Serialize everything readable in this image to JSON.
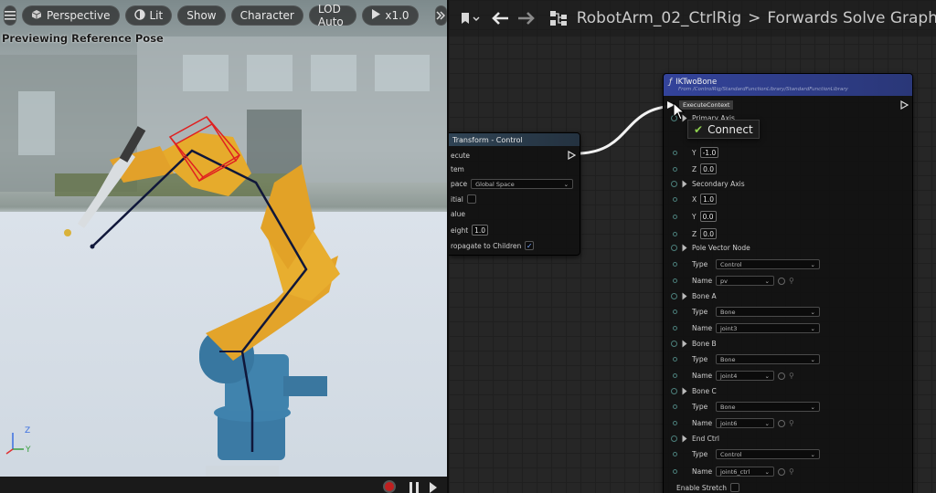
{
  "viewport": {
    "toolbar": {
      "menu_icon": "hamburger-menu-icon",
      "perspective_label": "Perspective",
      "lit_label": "Lit",
      "show_label": "Show",
      "character_label": "Character",
      "lod_label": "LOD Auto",
      "speed_label": "x1.0",
      "more_icon": "double-chevron-right-icon"
    },
    "status": "Previewing Reference Pose",
    "axis_labels": {
      "z": "Z",
      "y": "Y"
    }
  },
  "graph": {
    "breadcrumb": {
      "asset": "RobotArm_02_CtrlRig",
      "separator": ">",
      "graph_name": "Forwards Solve Graph"
    },
    "node_transform": {
      "title": "Transform - Control",
      "rows": {
        "execute": "ecute",
        "item": "tem",
        "space_label": "pace",
        "space_value": "Global Space",
        "initial": "itial",
        "value": "alue",
        "weight_label": "eight",
        "weight_value": "1.0",
        "propagate": "ropagate to Children"
      }
    },
    "node_ik": {
      "title": "IKTwoBone",
      "subtitle": "From /ControlRig/StandardFunctionLibrary/StandardFunctionLibrary",
      "execute_context_tooltip": "ExecuteContext",
      "connect_tooltip": "Connect",
      "primary_axis_label": "Primary Axis",
      "primary": {
        "y": "-1.0",
        "z": "0.0"
      },
      "secondary_axis_label": "Secondary Axis",
      "secondary": {
        "x": "1.0",
        "y": "0.0",
        "z": "0.0"
      },
      "axis_letters": {
        "x": "X",
        "y": "Y",
        "z": "Z"
      },
      "pole_vector_label": "Pole Vector Node",
      "pole_type": "Control",
      "pole_name": "pv",
      "bone_a_label": "Bone A",
      "bone_a_type": "Bone",
      "bone_a_name": "joint3",
      "bone_b_label": "Bone B",
      "bone_b_type": "Bone",
      "bone_b_name": "joint4",
      "bone_c_label": "Bone C",
      "bone_c_type": "Bone",
      "bone_c_name": "joint6",
      "end_ctrl_label": "End Ctrl",
      "end_ctrl_type": "Control",
      "end_ctrl_name": "joint6_ctrl",
      "type_label": "Type",
      "name_label": "Name",
      "enable_stretch_label": "Enable Stretch"
    }
  },
  "colors": {
    "ik_header": "#2c3a8a",
    "transform_header": "#2f4354",
    "robot_yellow": "#e6a92a",
    "robot_blue": "#3f7fa8",
    "wire": "#f2f2f2"
  }
}
